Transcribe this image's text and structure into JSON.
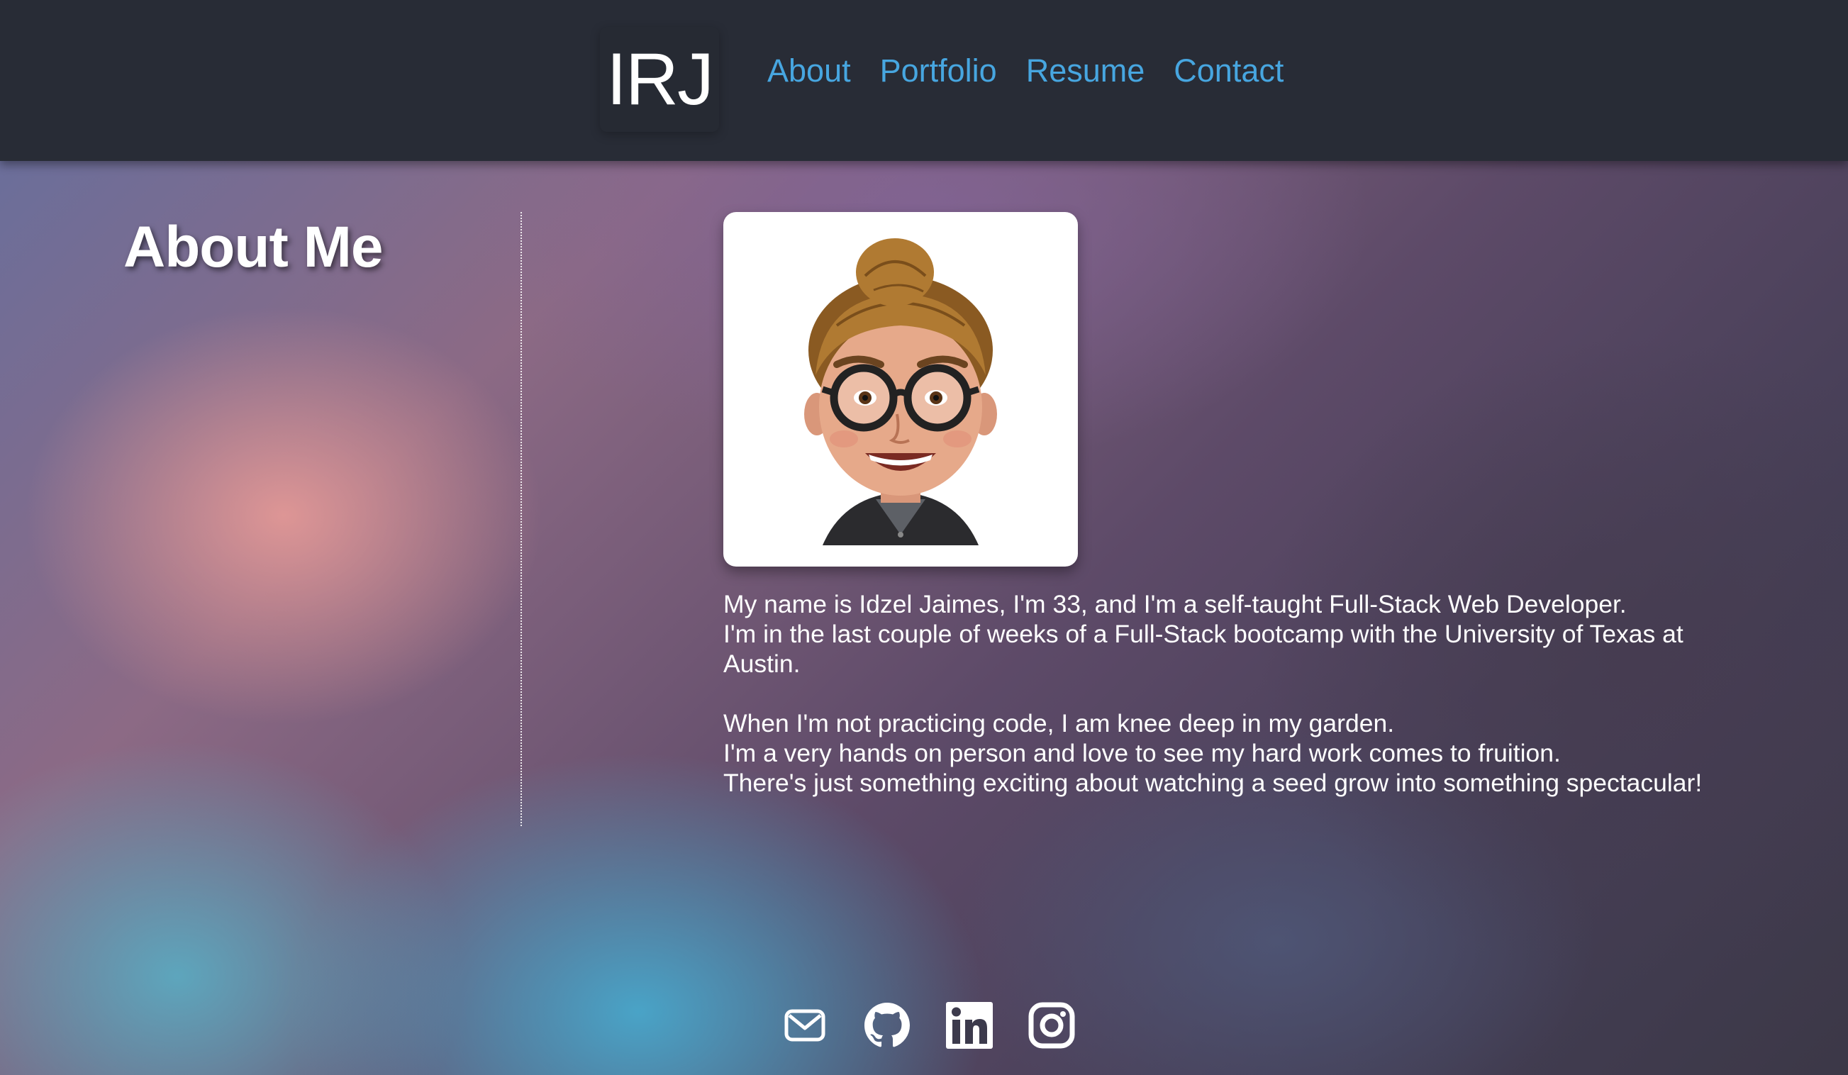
{
  "header": {
    "brand": "IRJ",
    "nav": [
      {
        "label": "About"
      },
      {
        "label": "Portfolio"
      },
      {
        "label": "Resume"
      },
      {
        "label": "Contact"
      }
    ]
  },
  "about": {
    "title": "About Me",
    "paragraph1": [
      "My name is Idzel Jaimes, I'm 33, and I'm a self-taught Full-Stack Web Developer.",
      "I'm in the last couple of weeks of a Full-Stack bootcamp with the University of Texas at Austin."
    ],
    "paragraph2": [
      "When I'm not practicing code, I am knee deep in my garden.",
      "I'm a very hands on person and love to see my hard work comes to fruition.",
      "There's just something exciting about watching a seed grow into something spectacular!"
    ]
  },
  "socials": [
    {
      "icon": "email-icon"
    },
    {
      "icon": "github-icon"
    },
    {
      "icon": "linkedin-icon"
    },
    {
      "icon": "instagram-icon"
    }
  ],
  "colors": {
    "header_bg": "#282c36",
    "nav_link": "#47a6e0",
    "text": "#ffffff"
  }
}
